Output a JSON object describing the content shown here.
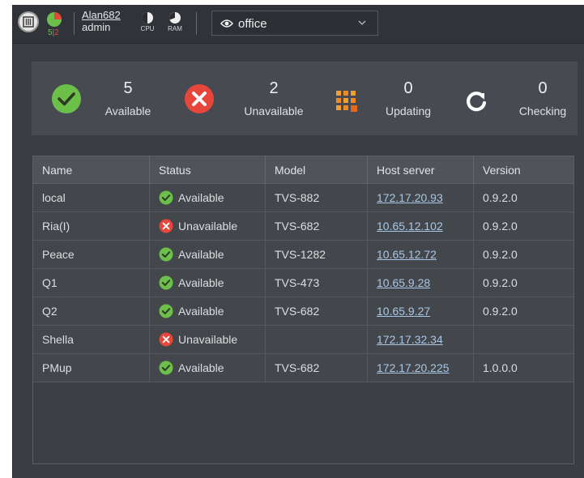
{
  "header": {
    "counts": {
      "available": "5",
      "unavailable": "2"
    },
    "user": {
      "name": "Alan682",
      "role": "admin"
    },
    "meters": [
      {
        "label": "CPU"
      },
      {
        "label": "RAM"
      }
    ],
    "site_select": {
      "value": "office",
      "icon": "eye-icon"
    }
  },
  "summary": [
    {
      "count": "5",
      "label": "Available",
      "icon": "check-circle-icon",
      "color": "#6cc04a"
    },
    {
      "count": "2",
      "label": "Unavailable",
      "icon": "x-circle-icon",
      "color": "#e8463a"
    },
    {
      "count": "0",
      "label": "Updating",
      "icon": "grid-update-icon",
      "color": "#f08a24"
    },
    {
      "count": "0",
      "label": "Checking",
      "icon": "refresh-icon",
      "color": "#ffffff"
    }
  ],
  "table": {
    "columns": [
      "Name",
      "Status",
      "Model",
      "Host server",
      "Version"
    ],
    "rows": [
      {
        "name": "local",
        "status": "Available",
        "model": "TVS-882",
        "host": "172.17.20.93",
        "version": "0.9.2.0"
      },
      {
        "name": "Ria(I)",
        "status": "Unavailable",
        "model": "TVS-682",
        "host": "10.65.12.102",
        "version": "0.9.2.0"
      },
      {
        "name": "Peace",
        "status": "Available",
        "model": "TVS-1282",
        "host": "10.65.12.72",
        "version": "0.9.2.0"
      },
      {
        "name": "Q1",
        "status": "Available",
        "model": "TVS-473",
        "host": "10.65.9.28",
        "version": "0.9.2.0"
      },
      {
        "name": "Q2",
        "status": "Available",
        "model": "TVS-682",
        "host": "10.65.9.27",
        "version": "0.9.2.0"
      },
      {
        "name": "Shella",
        "status": "Unavailable",
        "model": "",
        "host": "172.17.32.34",
        "version": ""
      },
      {
        "name": "PMup",
        "status": "Available",
        "model": "TVS-682",
        "host": "172.17.20.225",
        "version": "1.0.0.0"
      }
    ]
  }
}
